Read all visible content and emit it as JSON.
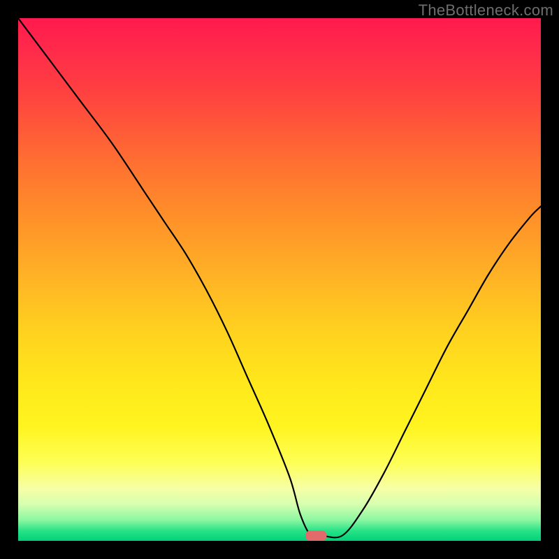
{
  "watermark": "TheBottleneck.com",
  "chart_data": {
    "type": "line",
    "title": "",
    "xlabel": "",
    "ylabel": "",
    "xlim": [
      0,
      100
    ],
    "ylim": [
      0,
      100
    ],
    "grid": false,
    "legend": false,
    "series": [
      {
        "name": "bottleneck-curve",
        "x": [
          0,
          6,
          12,
          18,
          24,
          28,
          32,
          36,
          40,
          44,
          48,
          52,
          54,
          56,
          58,
          62,
          66,
          70,
          74,
          78,
          82,
          86,
          90,
          94,
          98,
          100
        ],
        "values": [
          100,
          92,
          84,
          76,
          67,
          61,
          55,
          48,
          40,
          31,
          22,
          12,
          5,
          1,
          1,
          1,
          6,
          13,
          21,
          29,
          37,
          44,
          51,
          57,
          62,
          64
        ]
      }
    ],
    "marker": {
      "x": 57,
      "y": 1,
      "shape": "rounded-rect",
      "color": "#e36a6a"
    },
    "background_gradient": {
      "direction": "top-to-bottom",
      "stops": [
        {
          "pos": 0,
          "color": "#ff1a4d"
        },
        {
          "pos": 50,
          "color": "#ffb022"
        },
        {
          "pos": 80,
          "color": "#fff41f"
        },
        {
          "pos": 100,
          "color": "#00d179"
        }
      ]
    }
  }
}
